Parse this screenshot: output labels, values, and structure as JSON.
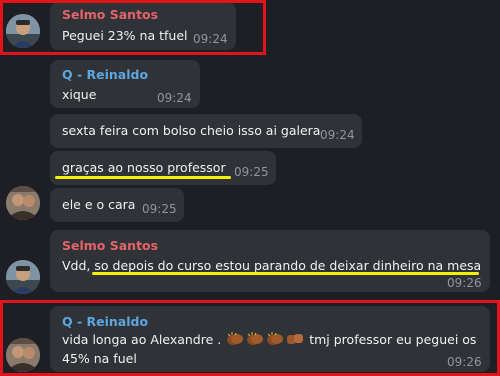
{
  "messages": [
    {
      "sender": "Selmo Santos",
      "text": "Peguei 23% na tfuel",
      "time": "09:24"
    },
    {
      "sender": "Q - Reinaldo",
      "text": "xique",
      "time": "09:24"
    },
    {
      "text": "sexta feira com bolso cheio isso ai galera",
      "time": "09:24"
    },
    {
      "text": "graças ao nosso professor",
      "time": "09:25"
    },
    {
      "text": "ele e o cara",
      "time": "09:25"
    },
    {
      "sender": "Selmo Santos",
      "text_prefix": "Vdd, ",
      "text_highlight": "so depois do curso estou parando de deixar dinheiro na mesa",
      "time": "09:26"
    },
    {
      "sender": "Q - Reinaldo",
      "line1_start": "vida longa ao Alexandre .",
      "line1_end": "tmj professor eu peguei os",
      "line2": "45%  na fuel",
      "time": "09:26"
    }
  ],
  "colors": {
    "selmo_name": "#e5636a",
    "reinaldo_name": "#5ea6e0",
    "bubble": "#2f3236",
    "background": "#1d1f24",
    "highlight": "#f2f200",
    "annotation_box": "#e2141b"
  },
  "icons": [
    "clapping-hands-emoji",
    "clapping-hands-emoji",
    "clapping-hands-emoji",
    "fist-bump-emoji"
  ]
}
